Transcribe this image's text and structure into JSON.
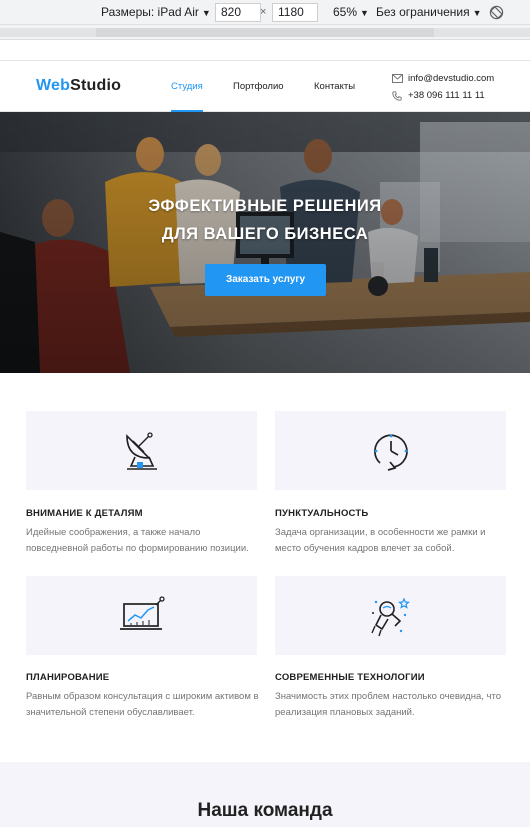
{
  "devtools": {
    "dimensions_label": "Размеры: iPad Air",
    "width": "820",
    "times": "×",
    "height": "1180",
    "zoom": "65%",
    "throttle": "Без ограничения"
  },
  "header": {
    "logo_web": "Web",
    "logo_studio": "Studio",
    "nav": [
      "Студия",
      "Портфолио",
      "Контакты"
    ],
    "email": "info@devstudio.com",
    "phone": "+38 096 111 11 11"
  },
  "hero": {
    "title_line1": "ЭФФЕКТИВНЫЕ РЕШЕНИЯ",
    "title_line2": "ДЛЯ ВАШЕГО БИЗНЕСА",
    "button": "Заказать услугу"
  },
  "features": [
    {
      "icon": "satellite-dish-icon",
      "title": "ВНИМАНИЕ К ДЕТАЛЯМ",
      "text": "Идейные соображения, а также начало повседневной работы по формированию позиции."
    },
    {
      "icon": "clock-icon",
      "title": "ПУНКТУАЛЬНОСТЬ",
      "text": "Задача организации, в особенности же рамки и место обучения кадров влечет за собой."
    },
    {
      "icon": "chart-monitor-icon",
      "title": "ПЛАНИРОВАНИЕ",
      "text": "Равным образом консультация с широким активом в значительной степени обуславливает."
    },
    {
      "icon": "astronaut-icon",
      "title": "СОВРЕМЕННЫЕ ТЕХНОЛОГИИ",
      "text": "Значимость этих проблем настолько очевидна, что реализация плановых заданий."
    }
  ],
  "team": {
    "title": "Наша команда"
  },
  "colors": {
    "accent": "#2196f3",
    "section_bg": "#f5f4fa",
    "text": "#212121",
    "muted": "#757575"
  }
}
